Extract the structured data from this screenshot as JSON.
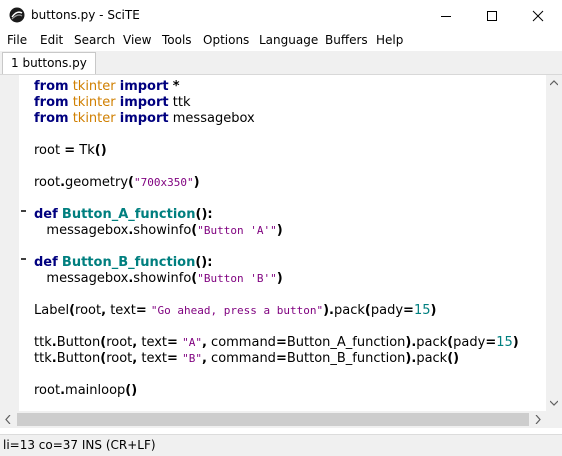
{
  "window": {
    "title": "buttons.py - SciTE"
  },
  "menu": [
    "File",
    "Edit",
    "Search",
    "View",
    "Tools",
    "Options",
    "Language",
    "Buffers",
    "Help"
  ],
  "tabs": [
    {
      "label": "1 buttons.py"
    }
  ],
  "editor": {
    "lines": [
      [
        [
          "kw",
          "from"
        ],
        [
          "t",
          " "
        ],
        [
          "mod",
          "tkinter"
        ],
        [
          "t",
          " "
        ],
        [
          "kw",
          "import"
        ],
        [
          "t",
          " "
        ],
        [
          "op",
          "*"
        ]
      ],
      [
        [
          "kw",
          "from"
        ],
        [
          "t",
          " "
        ],
        [
          "mod",
          "tkinter"
        ],
        [
          "t",
          " "
        ],
        [
          "kw",
          "import"
        ],
        [
          "t",
          " "
        ],
        [
          "id",
          "ttk"
        ]
      ],
      [
        [
          "kw",
          "from"
        ],
        [
          "t",
          " "
        ],
        [
          "mod",
          "tkinter"
        ],
        [
          "t",
          " "
        ],
        [
          "kw",
          "import"
        ],
        [
          "t",
          " "
        ],
        [
          "id",
          "messagebox"
        ]
      ],
      [],
      [
        [
          "id",
          "root"
        ],
        [
          "t",
          " "
        ],
        [
          "op",
          "="
        ],
        [
          "t",
          " "
        ],
        [
          "id",
          "Tk"
        ],
        [
          "op",
          "()"
        ]
      ],
      [],
      [
        [
          "id",
          "root"
        ],
        [
          "op",
          "."
        ],
        [
          "id",
          "geometry"
        ],
        [
          "op",
          "("
        ],
        [
          "str",
          "\"700x350\""
        ],
        [
          "op",
          ")"
        ]
      ],
      [],
      [
        [
          "kw",
          "def"
        ],
        [
          "t",
          " "
        ],
        [
          "fn",
          "Button_A_function"
        ],
        [
          "op",
          "():"
        ]
      ],
      [
        [
          "t",
          "   "
        ],
        [
          "id",
          "messagebox"
        ],
        [
          "op",
          "."
        ],
        [
          "id",
          "showinfo"
        ],
        [
          "op",
          "("
        ],
        [
          "str",
          "\"Button 'A'\""
        ],
        [
          "op",
          ")"
        ]
      ],
      [],
      [
        [
          "kw",
          "def"
        ],
        [
          "t",
          " "
        ],
        [
          "fn",
          "Button_B_function"
        ],
        [
          "op",
          "():"
        ]
      ],
      [
        [
          "t",
          "   "
        ],
        [
          "id",
          "messagebox"
        ],
        [
          "op",
          "."
        ],
        [
          "id",
          "showinfo"
        ],
        [
          "op",
          "("
        ],
        [
          "str",
          "\"Button 'B'\""
        ],
        [
          "op",
          ")"
        ]
      ],
      [],
      [
        [
          "id",
          "Label"
        ],
        [
          "op",
          "("
        ],
        [
          "id",
          "root"
        ],
        [
          "op",
          ","
        ],
        [
          "t",
          " "
        ],
        [
          "id",
          "text"
        ],
        [
          "op",
          "="
        ],
        [
          "t",
          " "
        ],
        [
          "str",
          "\"Go ahead, press a button\""
        ],
        [
          "op",
          ")."
        ],
        [
          "id",
          "pack"
        ],
        [
          "op",
          "("
        ],
        [
          "id",
          "pady"
        ],
        [
          "op",
          "="
        ],
        [
          "num",
          "15"
        ],
        [
          "op",
          ")"
        ]
      ],
      [],
      [
        [
          "id",
          "ttk"
        ],
        [
          "op",
          "."
        ],
        [
          "id",
          "Button"
        ],
        [
          "op",
          "("
        ],
        [
          "id",
          "root"
        ],
        [
          "op",
          ","
        ],
        [
          "t",
          " "
        ],
        [
          "id",
          "text"
        ],
        [
          "op",
          "="
        ],
        [
          "t",
          " "
        ],
        [
          "str",
          "\"A\""
        ],
        [
          "op",
          ","
        ],
        [
          "t",
          " "
        ],
        [
          "id",
          "command"
        ],
        [
          "op",
          "="
        ],
        [
          "id",
          "Button_A_function"
        ],
        [
          "op",
          ")."
        ],
        [
          "id",
          "pack"
        ],
        [
          "op",
          "("
        ],
        [
          "id",
          "pady"
        ],
        [
          "op",
          "="
        ],
        [
          "num",
          "15"
        ],
        [
          "op",
          ")"
        ]
      ],
      [
        [
          "id",
          "ttk"
        ],
        [
          "op",
          "."
        ],
        [
          "id",
          "Button"
        ],
        [
          "op",
          "("
        ],
        [
          "id",
          "root"
        ],
        [
          "op",
          ","
        ],
        [
          "t",
          " "
        ],
        [
          "id",
          "text"
        ],
        [
          "op",
          "="
        ],
        [
          "t",
          " "
        ],
        [
          "str",
          "\"B\""
        ],
        [
          "op",
          ","
        ],
        [
          "t",
          " "
        ],
        [
          "id",
          "command"
        ],
        [
          "op",
          "="
        ],
        [
          "id",
          "Button_B_function"
        ],
        [
          "op",
          ")."
        ],
        [
          "id",
          "pack"
        ],
        [
          "op",
          "()"
        ]
      ],
      [],
      [
        [
          "id",
          "root"
        ],
        [
          "op",
          "."
        ],
        [
          "id",
          "mainloop"
        ],
        [
          "op",
          "()"
        ]
      ]
    ]
  },
  "status": {
    "text": "li=13 co=37 INS (CR+LF)"
  }
}
